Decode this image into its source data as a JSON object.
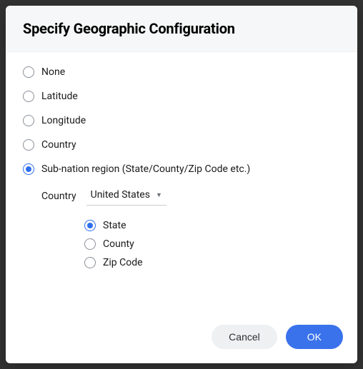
{
  "dialog": {
    "title": "Specify Geographic Configuration",
    "options": {
      "none": "None",
      "latitude": "Latitude",
      "longitude": "Longitude",
      "country": "Country",
      "subnation": "Sub-nation region (State/County/Zip Code etc.)"
    },
    "subnation": {
      "country_label": "Country",
      "country_value": "United States",
      "levels": {
        "state": "State",
        "county": "County",
        "zip": "Zip Code"
      }
    },
    "buttons": {
      "cancel": "Cancel",
      "ok": "OK"
    }
  }
}
